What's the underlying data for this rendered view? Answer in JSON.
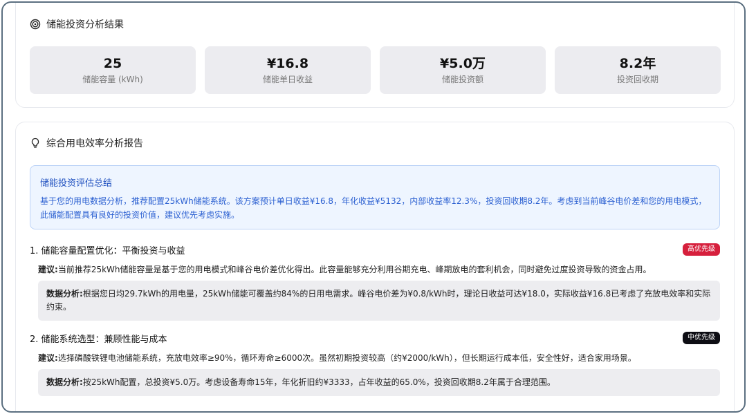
{
  "result": {
    "title": "储能投资分析结果",
    "stats": [
      {
        "value": "25",
        "label": "储能容量 (kWh)"
      },
      {
        "value": "¥16.8",
        "label": "储能单日收益"
      },
      {
        "value": "¥5.0万",
        "label": "储能投资额"
      },
      {
        "value": "8.2年",
        "label": "投资回收期"
      }
    ]
  },
  "report": {
    "title": "综合用电效率分析报告",
    "summary": {
      "title": "储能投资评估总结",
      "text": "基于您的用电数据分析，推荐配置25kWh储能系统。该方案预计单日收益¥16.8，年化收益¥5132，内部收益率12.3%，投资回收期8.2年。考虑到当前峰谷电价差和您的用电模式，此储能配置具有良好的投资价值，建议优先考虑实施。"
    },
    "suggestion_label": "建议:",
    "analysis_label": "数据分析:",
    "items": [
      {
        "title": "1. 储能容量配置优化：平衡投资与收益",
        "badge": "高优先级",
        "suggestion": "当前推荐25kWh储能容量是基于您的用电模式和峰谷电价差优化得出。此容量能够充分利用谷期充电、峰期放电的套利机会，同时避免过度投资导致的资金占用。",
        "analysis": "根据您日均29.7kWh的用电量，25kWh储能可覆盖约84%的日用电需求。峰谷电价差为¥0.8/kWh时，理论日收益可达¥18.0，实际收益¥16.8已考虑了充放电效率和实际约束。"
      },
      {
        "title": "2. 储能系统选型：兼顾性能与成本",
        "badge": "中优先级",
        "suggestion": "选择磷酸铁锂电池储能系统，充放电效率≥90%，循环寿命≥6000次。虽然初期投资较高（约¥2000/kWh），但长期运行成本低，安全性好，适合家用场景。",
        "analysis": "按25kWh配置，总投资¥5.0万。考虑设备寿命15年，年化折旧约¥3333，占年收益的65.0%，投资回收期8.2年属于合理范围。"
      }
    ]
  }
}
